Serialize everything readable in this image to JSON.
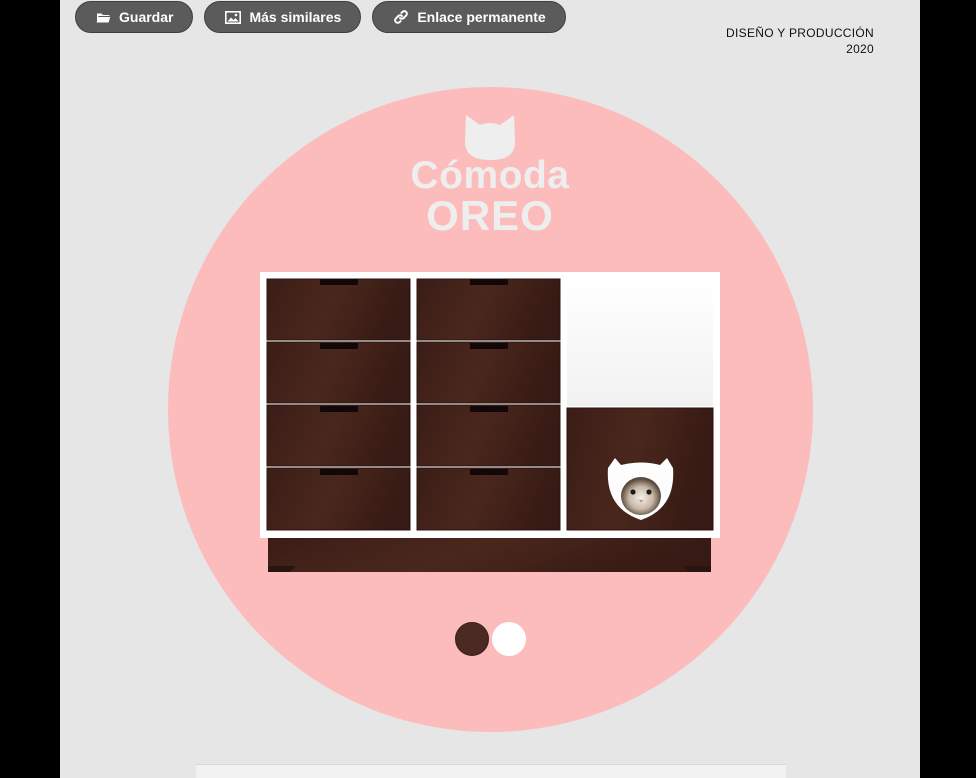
{
  "toolbar": {
    "save": {
      "label": "Guardar",
      "icon": "folder-icon"
    },
    "similar": {
      "label": "Más similares",
      "icon": "image-icon"
    },
    "permalink": {
      "label": "Enlace permanente",
      "icon": "link-icon"
    }
  },
  "credit": {
    "line1": "DISEÑO Y PRODUCCIÓN",
    "line2": "2020"
  },
  "product": {
    "logo": "cat-head-icon",
    "title_line1": "Cómoda",
    "title_line2": "OREO"
  },
  "swatches": [
    {
      "name": "dark-walnut",
      "color": "#4a2a22"
    },
    {
      "name": "white",
      "color": "#ffffff"
    }
  ],
  "colors": {
    "background": "#e6e6e6",
    "circle": "#fcbcbc",
    "button": "#5b5b5b",
    "wood": "#3a1f18"
  }
}
